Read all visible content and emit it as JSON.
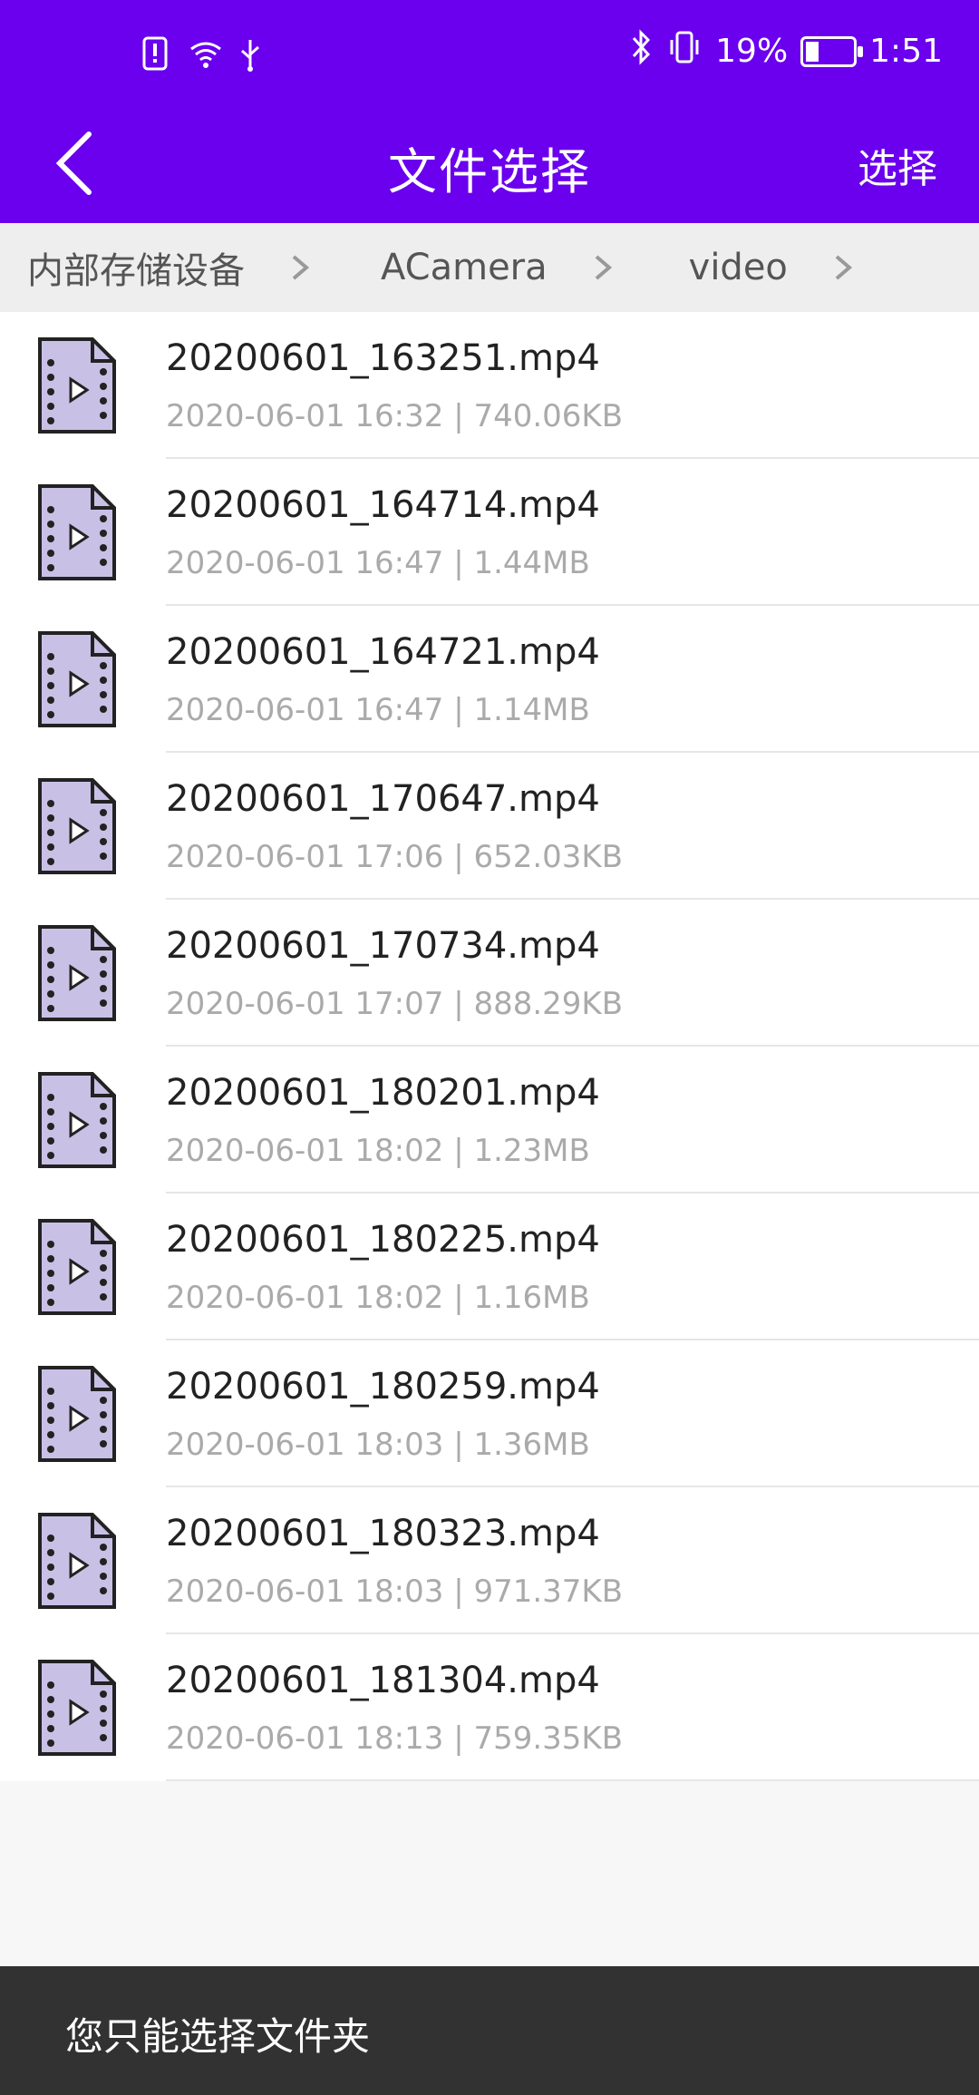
{
  "status": {
    "battery_text": "19%",
    "time": "1:51"
  },
  "header": {
    "title": "文件选择",
    "action": "选择"
  },
  "breadcrumbs": [
    {
      "label": "内部存储设备"
    },
    {
      "label": "ACamera"
    },
    {
      "label": "video"
    }
  ],
  "files": [
    {
      "name": "20200601_163251.mp4",
      "meta": "2020-06-01 16:32  |  740.06KB"
    },
    {
      "name": "20200601_164714.mp4",
      "meta": "2020-06-01 16:47  |  1.44MB"
    },
    {
      "name": "20200601_164721.mp4",
      "meta": "2020-06-01 16:47  |  1.14MB"
    },
    {
      "name": "20200601_170647.mp4",
      "meta": "2020-06-01 17:06  |  652.03KB"
    },
    {
      "name": "20200601_170734.mp4",
      "meta": "2020-06-01 17:07  |  888.29KB"
    },
    {
      "name": "20200601_180201.mp4",
      "meta": "2020-06-01 18:02  |  1.23MB"
    },
    {
      "name": "20200601_180225.mp4",
      "meta": "2020-06-01 18:02  |  1.16MB"
    },
    {
      "name": "20200601_180259.mp4",
      "meta": "2020-06-01 18:03  |  1.36MB"
    },
    {
      "name": "20200601_180323.mp4",
      "meta": "2020-06-01 18:03  |  971.37KB"
    },
    {
      "name": "20200601_181304.mp4",
      "meta": "2020-06-01 18:13  |  759.35KB"
    }
  ],
  "toast": {
    "message": "您只能选择文件夹"
  },
  "colors": {
    "accent": "#6a00ee",
    "file_icon_fill": "#c9c0e6",
    "toast_bg": "#323232"
  },
  "icons": {
    "status_left": [
      "alert-sim-icon",
      "wifi-icon",
      "usb-icon"
    ],
    "status_right": [
      "bluetooth-icon",
      "vibrate-icon",
      "battery-icon"
    ],
    "file": "video-file-icon"
  }
}
